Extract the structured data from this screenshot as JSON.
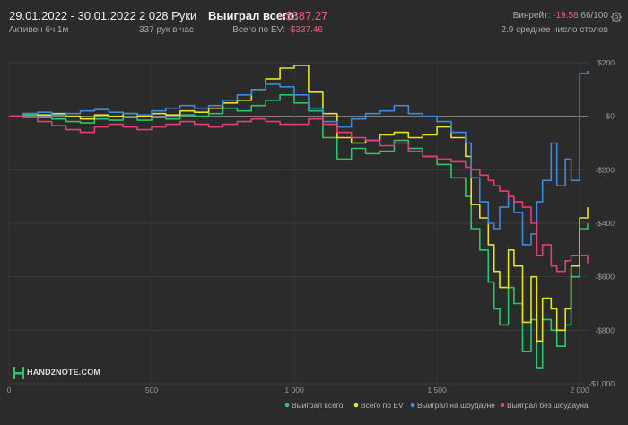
{
  "header": {
    "date_range": "29.01.2022 - 30.01.2022",
    "active": "Активен 6ч 1м",
    "hands": "2 028 Руки",
    "hands_per_hour": "337 рук в час",
    "won_total_label": "Выиграл всего:",
    "won_total_value": "-$387.27",
    "ev_label": "Всего по EV:",
    "ev_value": "-$337.46",
    "winrate_label": "Винрейт:",
    "winrate_value": "-19.58",
    "winrate_suffix": "66/100",
    "tables": "2.9 среднее число столов",
    "settings_icon": "gear-icon"
  },
  "logo": {
    "text": "HAND2NOTE.COM",
    "color": "#35c06a"
  },
  "chart_data": {
    "type": "line",
    "x_range": [
      0,
      2028
    ],
    "ylim": [
      -1000,
      200
    ],
    "x_ticks": [
      {
        "value": 0,
        "label": "0"
      },
      {
        "value": 500,
        "label": "500"
      },
      {
        "value": 1000,
        "label": "1 000"
      },
      {
        "value": 1500,
        "label": "1 500"
      },
      {
        "value": 2000,
        "label": "2 000"
      }
    ],
    "y_ticks": [
      {
        "value": 200,
        "label": "$200"
      },
      {
        "value": 0,
        "label": "$0"
      },
      {
        "value": -200,
        "label": "-$200"
      },
      {
        "value": -400,
        "label": "-$400"
      },
      {
        "value": -600,
        "label": "-$600"
      },
      {
        "value": -800,
        "label": "-$800"
      },
      {
        "value": -1000,
        "label": "-$1,000"
      }
    ],
    "grid": true,
    "legend_position": "bottom-right",
    "series": [
      {
        "name": "Выиграл всего",
        "color": "#2ec56a",
        "x": [
          0,
          50,
          100,
          150,
          200,
          250,
          300,
          350,
          400,
          450,
          500,
          550,
          600,
          650,
          700,
          750,
          800,
          850,
          900,
          950,
          1000,
          1050,
          1100,
          1150,
          1200,
          1250,
          1300,
          1350,
          1400,
          1450,
          1500,
          1550,
          1600,
          1620,
          1650,
          1680,
          1700,
          1720,
          1750,
          1770,
          1800,
          1830,
          1850,
          1870,
          1900,
          1920,
          1950,
          1970,
          2000,
          2028
        ],
        "y": [
          0,
          5,
          -5,
          -10,
          -20,
          -25,
          -10,
          -15,
          -5,
          -15,
          -5,
          -10,
          5,
          0,
          10,
          30,
          20,
          40,
          60,
          80,
          50,
          20,
          -80,
          -160,
          -120,
          -140,
          -130,
          -90,
          -120,
          -150,
          -180,
          -230,
          -300,
          -420,
          -500,
          -620,
          -720,
          -780,
          -640,
          -700,
          -880,
          -760,
          -940,
          -760,
          -800,
          -860,
          -780,
          -600,
          -420,
          -400
        ]
      },
      {
        "name": "Всего по EV",
        "color": "#e5e22a",
        "x": [
          0,
          50,
          100,
          150,
          200,
          250,
          300,
          350,
          400,
          450,
          500,
          550,
          600,
          650,
          700,
          750,
          800,
          850,
          900,
          950,
          1000,
          1050,
          1100,
          1150,
          1200,
          1250,
          1300,
          1350,
          1400,
          1450,
          1500,
          1550,
          1600,
          1620,
          1650,
          1680,
          1700,
          1720,
          1750,
          1770,
          1800,
          1830,
          1850,
          1870,
          1900,
          1920,
          1950,
          1970,
          2000,
          2028
        ],
        "y": [
          0,
          10,
          5,
          10,
          0,
          -10,
          5,
          0,
          10,
          0,
          10,
          5,
          20,
          15,
          30,
          50,
          60,
          100,
          140,
          180,
          190,
          90,
          10,
          -80,
          -100,
          -90,
          -70,
          -60,
          -80,
          -70,
          -40,
          -80,
          -150,
          -330,
          -380,
          -480,
          -580,
          -640,
          -500,
          -560,
          -770,
          -600,
          -840,
          -680,
          -720,
          -800,
          -720,
          -560,
          -380,
          -340
        ]
      },
      {
        "name": "Выиграл на шоудауне",
        "color": "#3d8ad8",
        "x": [
          0,
          50,
          100,
          150,
          200,
          250,
          300,
          350,
          400,
          450,
          500,
          550,
          600,
          650,
          700,
          750,
          800,
          850,
          900,
          950,
          1000,
          1050,
          1100,
          1150,
          1200,
          1250,
          1300,
          1350,
          1400,
          1450,
          1500,
          1550,
          1600,
          1620,
          1650,
          1680,
          1700,
          1720,
          1750,
          1770,
          1800,
          1830,
          1850,
          1870,
          1900,
          1920,
          1950,
          1970,
          2000,
          2028
        ],
        "y": [
          0,
          10,
          15,
          5,
          10,
          20,
          25,
          15,
          10,
          5,
          20,
          30,
          40,
          30,
          40,
          60,
          80,
          100,
          120,
          110,
          80,
          30,
          -20,
          -40,
          -10,
          10,
          20,
          40,
          10,
          0,
          -20,
          -60,
          -100,
          -230,
          -320,
          -400,
          -420,
          -340,
          -300,
          -360,
          -480,
          -440,
          -320,
          -240,
          -100,
          -260,
          -160,
          -240,
          160,
          170
        ]
      },
      {
        "name": "Выиграл без шоудауна",
        "color": "#e2406e",
        "x": [
          0,
          50,
          100,
          150,
          200,
          250,
          300,
          350,
          400,
          450,
          500,
          550,
          600,
          650,
          700,
          750,
          800,
          850,
          900,
          950,
          1000,
          1050,
          1100,
          1150,
          1200,
          1250,
          1300,
          1350,
          1400,
          1450,
          1500,
          1550,
          1600,
          1620,
          1650,
          1680,
          1700,
          1720,
          1750,
          1770,
          1800,
          1830,
          1850,
          1870,
          1900,
          1920,
          1950,
          1970,
          2000,
          2028
        ],
        "y": [
          0,
          -5,
          -20,
          -35,
          -50,
          -60,
          -40,
          -30,
          -40,
          -50,
          -40,
          -30,
          -20,
          -30,
          -40,
          -30,
          -20,
          -10,
          -20,
          -30,
          -30,
          -10,
          -30,
          -60,
          -80,
          -90,
          -110,
          -100,
          -130,
          -150,
          -160,
          -170,
          -190,
          -200,
          -220,
          -240,
          -260,
          -280,
          -300,
          -320,
          -340,
          -400,
          -520,
          -480,
          -560,
          -580,
          -540,
          -520,
          -520,
          -550
        ]
      }
    ]
  }
}
